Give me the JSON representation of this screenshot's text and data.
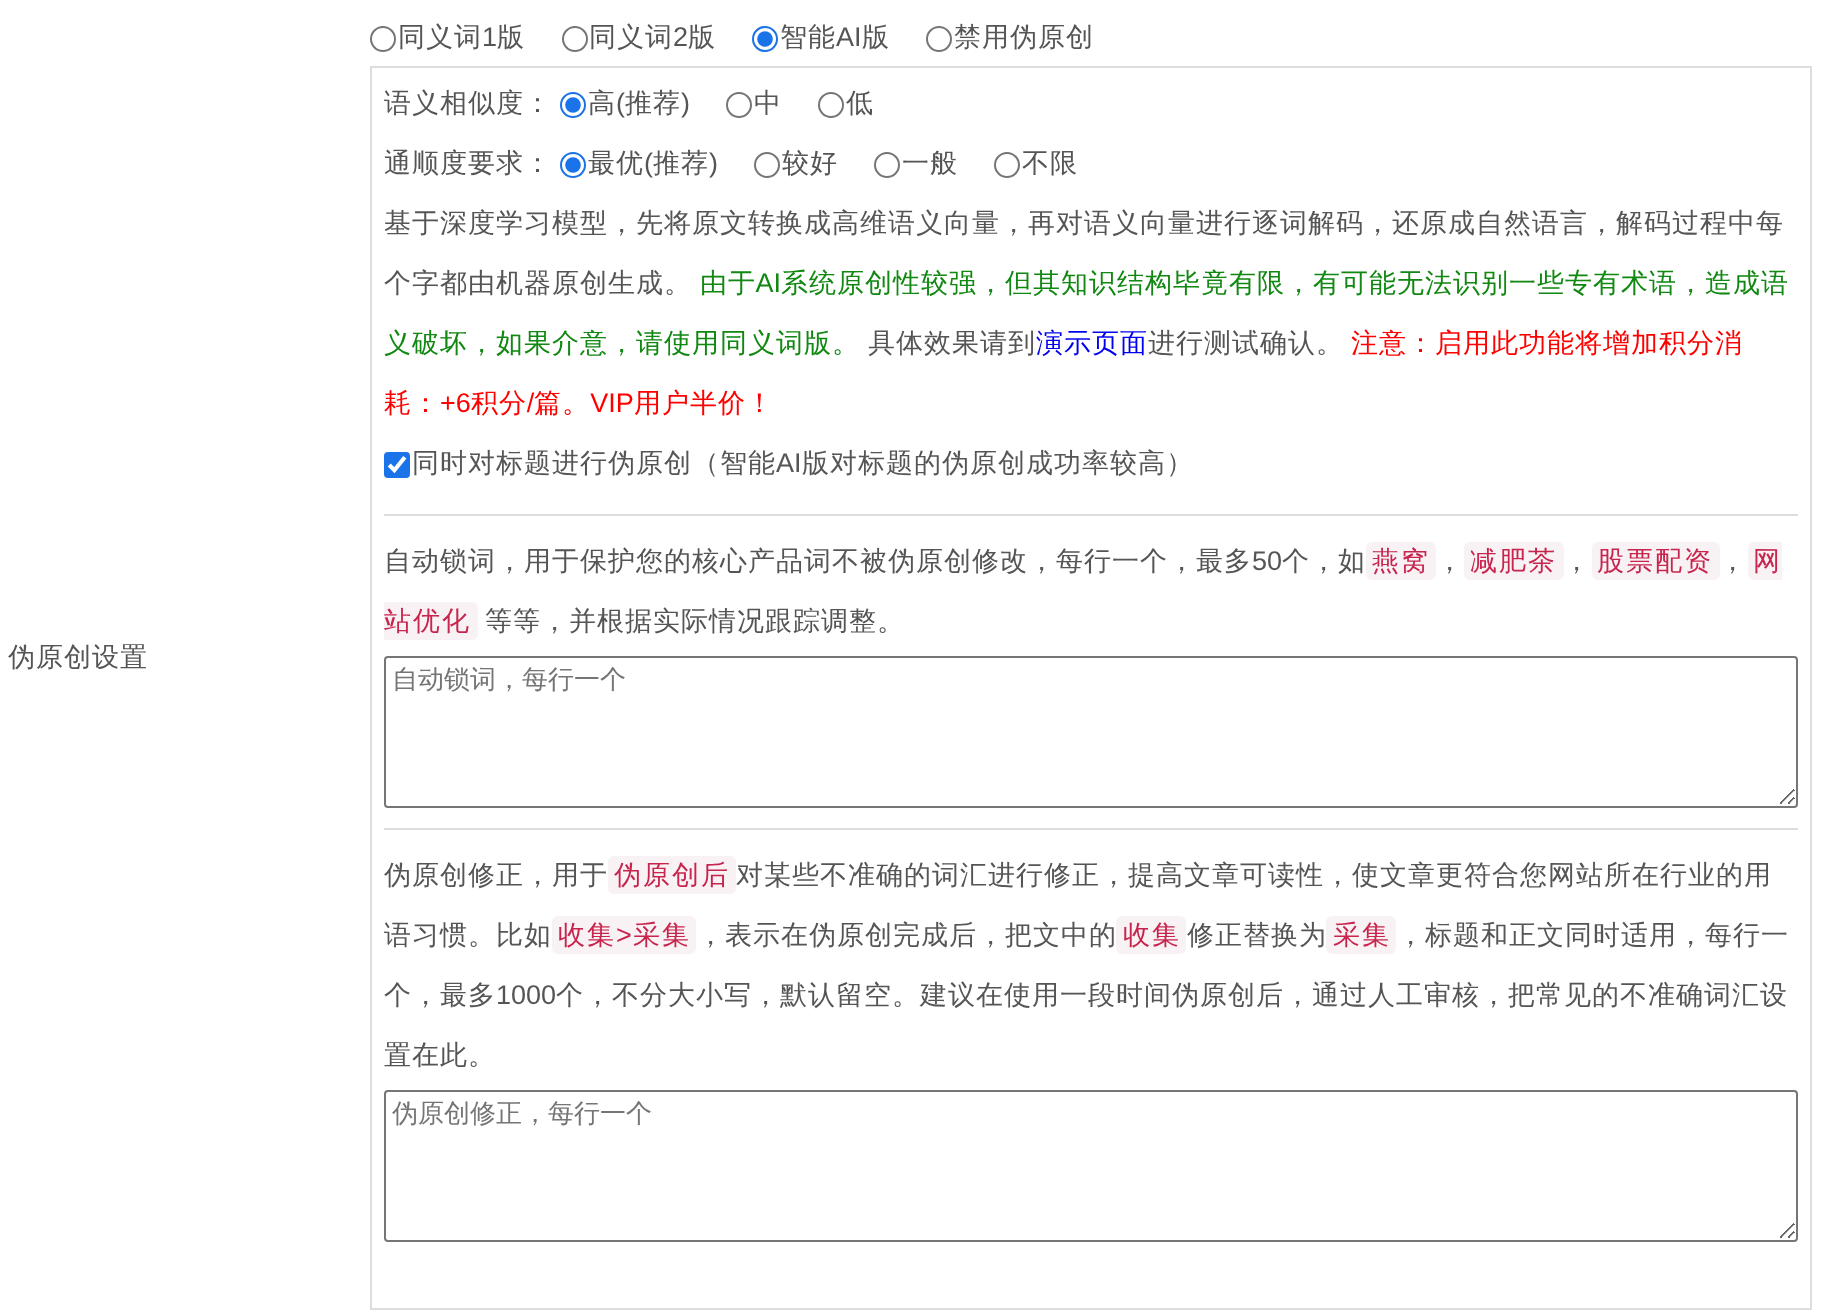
{
  "section_label": "伪原创设置",
  "mode_options": [
    {
      "label": "同义词1版",
      "selected": false
    },
    {
      "label": "同义词2版",
      "selected": false
    },
    {
      "label": "智能AI版",
      "selected": true
    },
    {
      "label": "禁用伪原创",
      "selected": false
    }
  ],
  "similarity": {
    "label": "语义相似度：",
    "options": [
      {
        "label": "高(推荐)",
        "selected": true
      },
      {
        "label": "中",
        "selected": false
      },
      {
        "label": "低",
        "selected": false
      }
    ]
  },
  "fluency": {
    "label": "通顺度要求：",
    "options": [
      {
        "label": "最优(推荐)",
        "selected": true
      },
      {
        "label": "较好",
        "selected": false
      },
      {
        "label": "一般",
        "selected": false
      },
      {
        "label": "不限",
        "selected": false
      }
    ]
  },
  "ai_description": [
    {
      "kind": "plain",
      "text": "基于深度学习模型，先将原文转换成高维语义向量，再对语义向量进行逐词解码，还原成自然语言，解码过程中每个字都由机器原创生成。 "
    },
    {
      "kind": "notice",
      "text": "由于AI系统原创性较强，但其知识结构毕竟有限，有可能无法识别一些专有术语，造成语义破坏，如果介意，请使用同义词版。"
    },
    {
      "kind": "plain",
      "text": " 具体效果请到"
    },
    {
      "kind": "link",
      "text": "演示页面"
    },
    {
      "kind": "plain",
      "text": "进行测试确认。 "
    },
    {
      "kind": "warning",
      "text": "注意：启用此功能将增加积分消耗：+6积分/篇。VIP用户半价！"
    }
  ],
  "title_option": {
    "label": "同时对标题进行伪原创（智能AI版对标题的伪原创成功率较高）",
    "checked": true
  },
  "lock_words": {
    "description": [
      {
        "kind": "plain",
        "text": "自动锁词，用于保护您的核心产品词不被伪原创修改，每行一个，最多50个，如"
      },
      {
        "kind": "tag",
        "text": "燕窝"
      },
      {
        "kind": "plain",
        "text": "，"
      },
      {
        "kind": "tag",
        "text": "减肥茶"
      },
      {
        "kind": "plain",
        "text": "，"
      },
      {
        "kind": "tag",
        "text": "股票配资"
      },
      {
        "kind": "plain",
        "text": "，"
      },
      {
        "kind": "tag",
        "text": "网站优化"
      },
      {
        "kind": "plain",
        "text": " 等等，并根据实际情况跟踪调整。"
      }
    ],
    "placeholder": "自动锁词，每行一个"
  },
  "corrections": {
    "description": [
      {
        "kind": "plain",
        "text": "伪原创修正，用于"
      },
      {
        "kind": "tag",
        "text": "伪原创后"
      },
      {
        "kind": "plain",
        "text": "对某些不准确的词汇进行修正，提高文章可读性，使文章更符合您网站所在行业的用语习惯。比如"
      },
      {
        "kind": "tag",
        "text": "收集>采集"
      },
      {
        "kind": "plain",
        "text": "，表示在伪原创完成后，把文中的"
      },
      {
        "kind": "tag",
        "text": "收集"
      },
      {
        "kind": "plain",
        "text": "修正替换为"
      },
      {
        "kind": "tag",
        "text": "采集"
      },
      {
        "kind": "plain",
        "text": "，标题和正文同时适用，每行一个，最多1000个，不分大小写，默认留空。建议在使用一段时间伪原创后，通过人工审核，把常见的不准确词汇设置在此。"
      }
    ],
    "placeholder": "伪原创修正，每行一个"
  }
}
